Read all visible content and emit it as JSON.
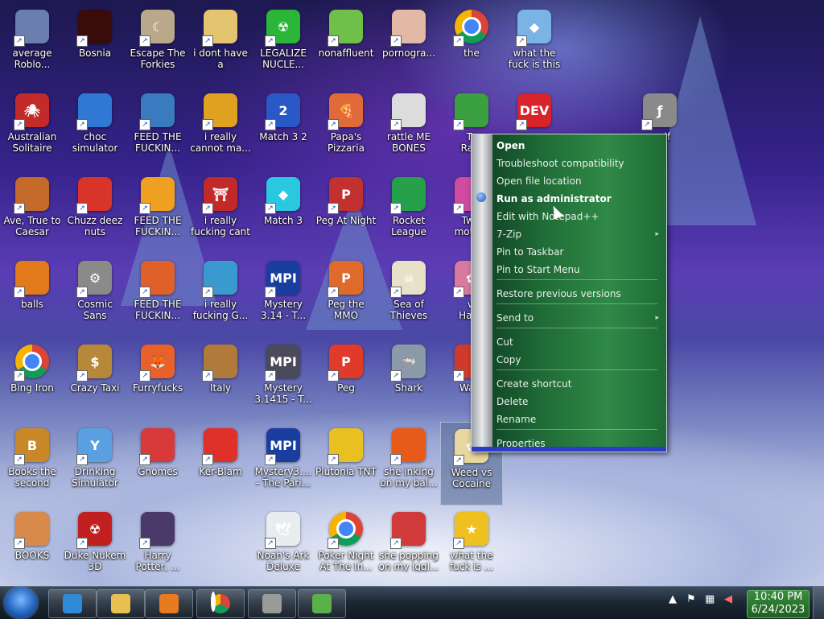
{
  "desktop_icons": [
    {
      "label": "average\nRoblo...",
      "icon": "recycle-bin-icon",
      "color": "#6a7fb0"
    },
    {
      "label": "Bosnia",
      "icon": "dark-orb-icon",
      "color": "#3a0b0b"
    },
    {
      "label": "Escape The\nForkies",
      "icon": "moon-icon",
      "color": "#b9a98a"
    },
    {
      "label": "i dont have a\njoke for thi...",
      "icon": "jester-icon",
      "color": "#e5c470"
    },
    {
      "label": "LEGALIZE\nNUCLE...",
      "icon": "radiation-icon",
      "color": "#2bb63a"
    },
    {
      "label": "nonaffluent",
      "icon": "frog-icon",
      "color": "#6ec04a"
    },
    {
      "label": "pornogra...",
      "icon": "anime-girl-icon",
      "color": "#e3b8a5"
    },
    {
      "label": "the",
      "icon": "chrome-icon",
      "color": "#db4437"
    },
    {
      "label": "what the\nfuck is this",
      "icon": "diamond-icon",
      "color": "#7ab4e6"
    },
    {
      "label": "Australian\nSolitaire",
      "icon": "spider-icon",
      "color": "#c32a2a"
    },
    {
      "label": "choc\nsimulator",
      "icon": "milk-carton-icon",
      "color": "#2f78d4"
    },
    {
      "label": "FEED THE\nFUCKIN...",
      "icon": "fish-tank-icon",
      "color": "#3a7bc0"
    },
    {
      "label": "i really\ncannot ma...",
      "icon": "scroll-icon",
      "color": "#e0a020"
    },
    {
      "label": "Match 3 2",
      "icon": "match-3-2-icon",
      "color": "#2a58c8"
    },
    {
      "label": "Papa's\nPizzaria",
      "icon": "pizza-icon",
      "color": "#e06a3a"
    },
    {
      "label": "rattle ME\nBONES",
      "icon": "skeleton-icon",
      "color": "#dcdcdc"
    },
    {
      "label": "To\nRa...",
      "icon": "compass-icon",
      "color": "#3aa040"
    },
    {
      "label": "",
      "icon": "devcpp-icon",
      "color": "#d8232a"
    },
    {
      "label": "rself\np...",
      "icon": "flash-icon",
      "color": "#8a8a8a"
    },
    {
      "label": "Ave, True to\nCaesar",
      "icon": "runner-icon",
      "color": "#c46a2a"
    },
    {
      "label": "Chuzz deez\nnuts",
      "icon": "chuzzle-icon",
      "color": "#d8342a"
    },
    {
      "label": "FEED THE\nFUCKIN...",
      "icon": "goldfish-icon",
      "color": "#f0a020"
    },
    {
      "label": "i really\nfucking cant",
      "icon": "torii-icon",
      "color": "#c22a2a"
    },
    {
      "label": "Match 3",
      "icon": "gem-icon",
      "color": "#2ac8e0"
    },
    {
      "label": "Peg At Night",
      "icon": "peggle-night-icon",
      "color": "#c23030"
    },
    {
      "label": "Rocket\nLeague",
      "icon": "rocket-league-icon",
      "color": "#26a04a"
    },
    {
      "label": "Twis\nmoth...",
      "icon": "balloon-icon",
      "color": "#d04aa0"
    },
    {
      "label": "balls",
      "icon": "stacked-boxes-icon",
      "color": "#e07a1a"
    },
    {
      "label": "Cosmic\nSans",
      "icon": "gear-icon",
      "color": "#8a8a8a"
    },
    {
      "label": "FEED THE\nFUCKIN...",
      "icon": "tropical-fish-icon",
      "color": "#e0602a"
    },
    {
      "label": "i really\nfucking G...",
      "icon": "neon-fish-icon",
      "color": "#3a9ad0"
    },
    {
      "label": "Mystery\n3.14 - T...",
      "icon": "mpi-icon",
      "color": "#1a3ea0"
    },
    {
      "label": "Peg the\nMMO",
      "icon": "peggle-icon",
      "color": "#e06a2a"
    },
    {
      "label": "Sea of\nThieves",
      "icon": "skull-icon",
      "color": "#e8e0c8"
    },
    {
      "label": "vi\nHar...",
      "icon": "flower-icon",
      "color": "#d87aa0"
    },
    {
      "label": "Bing Iron",
      "icon": "chrome-icon",
      "color": "#db4437"
    },
    {
      "label": "Crazy Taxi",
      "icon": "money-bag-icon",
      "color": "#b8883a"
    },
    {
      "label": "Furryfucks",
      "icon": "firefox-icon",
      "color": "#e8602a"
    },
    {
      "label": "Italy",
      "icon": "viking-ship-icon",
      "color": "#b07a3a"
    },
    {
      "label": "Mystery\n3.1415 - T...",
      "icon": "mpi-dark-icon",
      "color": "#4a4a5a"
    },
    {
      "label": "Peg",
      "icon": "peggle-icon",
      "color": "#e03a2a"
    },
    {
      "label": "Shark",
      "icon": "shark-icon",
      "color": "#8a9aa8"
    },
    {
      "label": "Wa...",
      "icon": "orb-icon",
      "color": "#d03a2a"
    },
    {
      "label": "Books the\nsecond",
      "icon": "book-icon",
      "color": "#c8882a"
    },
    {
      "label": "Drinking\nSimulator",
      "icon": "cocktail-icon",
      "color": "#5aa0e0"
    },
    {
      "label": "Gnomes",
      "icon": "gnome-icon",
      "color": "#d83a3a"
    },
    {
      "label": "Ker-Blam",
      "icon": "red-egg-icon",
      "color": "#e0302a"
    },
    {
      "label": "Mystery3....\n- The Pari...",
      "icon": "mpi-icon",
      "color": "#1a3ea0"
    },
    {
      "label": "Plutonia TNT",
      "icon": "plutonia-icon",
      "color": "#e8c020"
    },
    {
      "label": "she inking\non my bal...",
      "icon": "pen-icon",
      "color": "#e85a1a"
    },
    {
      "label": "Weed vs\nCocaine",
      "icon": "flower-pot-icon",
      "color": "#e8d8a0"
    },
    {
      "label": "BOOKS",
      "icon": "girl-face-icon",
      "color": "#d88a4a"
    },
    {
      "label": "Duke Nukem\n3D",
      "icon": "radiation-red-icon",
      "color": "#c02020"
    },
    {
      "label": "Harry\nPotter, ...",
      "icon": "tower-icon",
      "color": "#4a3a6a"
    },
    {
      "label": "Noah's Ark\nDeluxe",
      "icon": "dove-icon",
      "color": "#e8eef0"
    },
    {
      "label": "Poker Night\nAt The In...",
      "icon": "chrome-icon",
      "color": "#db4437"
    },
    {
      "label": "she popping\non my iggl...",
      "icon": "crab-icon",
      "color": "#d03a3a"
    },
    {
      "label": "what the\nfuck is ...",
      "icon": "star-icon",
      "color": "#f0c020"
    }
  ],
  "context_menu": {
    "items": [
      {
        "label": "Open",
        "bold": true
      },
      {
        "label": "Troubleshoot compatibility"
      },
      {
        "label": "Open file location"
      },
      {
        "label": "Run as administrator",
        "bold": true
      },
      {
        "label": "Edit with Notepad++"
      },
      {
        "label": "7-Zip",
        "submenu": true
      },
      {
        "label": "Pin to Taskbar"
      },
      {
        "label": "Pin to Start Menu"
      },
      {
        "label": "Restore previous versions"
      },
      {
        "label": "Send to",
        "submenu": true
      },
      {
        "label": "Cut"
      },
      {
        "label": "Copy"
      },
      {
        "label": "Create shortcut"
      },
      {
        "label": "Delete"
      },
      {
        "label": "Rename"
      },
      {
        "label": "Properties"
      }
    ],
    "submenu_arrow": "▸"
  },
  "taskbar": {
    "start_icon": "windows-start-icon",
    "pinned": [
      {
        "icon": "internet-explorer-icon",
        "color": "#2f8ad8"
      },
      {
        "icon": "file-explorer-icon",
        "color": "#e8c050"
      },
      {
        "icon": "media-player-icon",
        "color": "#e87a20"
      },
      {
        "icon": "chrome-icon",
        "color": "#db4437"
      },
      {
        "icon": "flash-icon",
        "color": "#9a9a9a"
      },
      {
        "icon": "notepad-plus-plus-icon",
        "color": "#5ab04a"
      }
    ],
    "tray": {
      "show_hidden": "▲",
      "flag": "⚑",
      "network": "▦",
      "volume": "◀"
    },
    "clock": {
      "time": "10:40 PM",
      "date": "6/24/2023"
    }
  }
}
